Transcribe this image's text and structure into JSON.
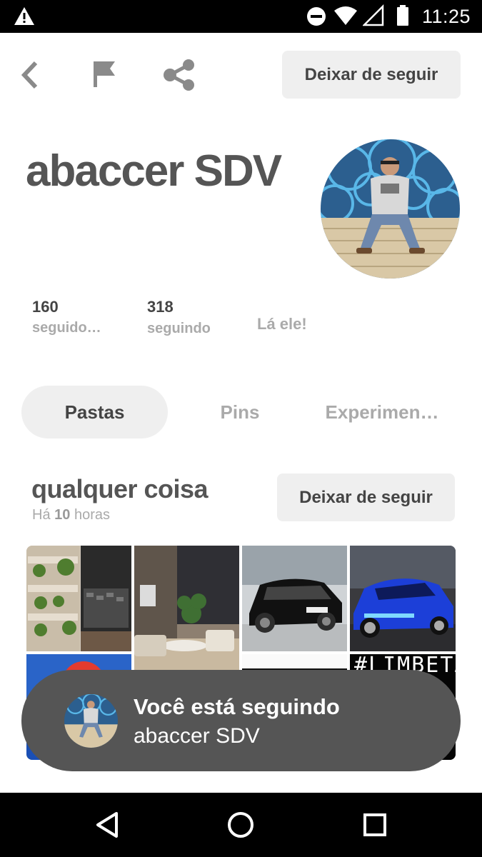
{
  "status_bar": {
    "time": "11:25",
    "icons": [
      "warning-icon",
      "do-not-disturb-icon",
      "wifi-icon",
      "cellular-signal-icon",
      "battery-icon"
    ]
  },
  "toolbar": {
    "icons": [
      "back-icon",
      "flag-icon",
      "share-icon"
    ],
    "unfollow_label": "Deixar de seguir"
  },
  "profile": {
    "name": "abaccer SDV",
    "followers_count": "160",
    "followers_label": "seguido…",
    "following_count": "318",
    "following_label": "seguindo",
    "bio": "Lá ele!"
  },
  "tabs": [
    {
      "label": "Pastas",
      "active": true
    },
    {
      "label": "Pins",
      "active": false
    },
    {
      "label": "Experimen…",
      "active": false
    }
  ],
  "board": {
    "title": "qualquer coisa",
    "time_prefix": "Há",
    "time_value": "10",
    "time_suffix": "horas",
    "unfollow_label": "Deixar de seguir",
    "pins": [
      "kitchen-photo",
      "balcony-photo",
      "black-suv-photo",
      "blue-sports-car-photo",
      "pop-art-photo",
      "blank-photo",
      "limbeta-photo"
    ],
    "pin_text": "#LIMBETA"
  },
  "toast": {
    "line1": "Você está seguindo",
    "line2": "abaccer SDV"
  },
  "nav_bar": {
    "icons": [
      "nav-back-icon",
      "nav-home-icon",
      "nav-recents-icon"
    ]
  },
  "colors": {
    "text_dark": "#555555",
    "text_muted": "#aaaaaa",
    "button_bg": "#efefef",
    "toast_bg": "#555555"
  }
}
